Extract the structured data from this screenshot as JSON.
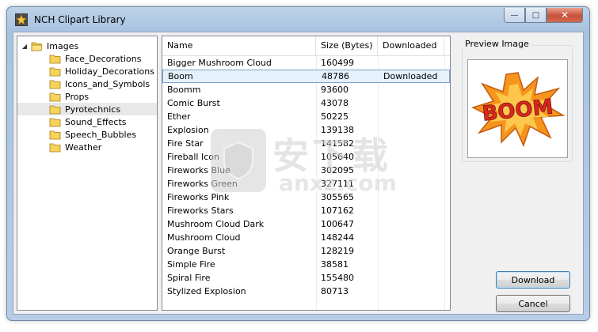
{
  "window": {
    "title": "NCH Clipart Library"
  },
  "caption_buttons": {
    "minimize": "—",
    "maximize": "□",
    "close": "✕"
  },
  "tree": {
    "root": {
      "label": "Images",
      "expander": "◢"
    },
    "items": [
      {
        "label": "Face_Decorations"
      },
      {
        "label": "Holiday_Decorations"
      },
      {
        "label": "Icons_and_Symbols"
      },
      {
        "label": "Props"
      },
      {
        "label": "Pyrotechnics",
        "selected": true
      },
      {
        "label": "Sound_Effects"
      },
      {
        "label": "Speech_Bubbles"
      },
      {
        "label": "Weather"
      }
    ]
  },
  "list": {
    "columns": {
      "name": "Name",
      "size": "Size (Bytes)",
      "downloaded": "Downloaded"
    },
    "rows": [
      {
        "name": "Bigger Mushroom Cloud",
        "size": "160499",
        "downloaded": ""
      },
      {
        "name": "Boom",
        "size": "48786",
        "downloaded": "Downloaded",
        "selected": true
      },
      {
        "name": "Boomm",
        "size": "93600",
        "downloaded": ""
      },
      {
        "name": "Comic Burst",
        "size": "43078",
        "downloaded": ""
      },
      {
        "name": "Ether",
        "size": "50225",
        "downloaded": ""
      },
      {
        "name": "Explosion",
        "size": "139138",
        "downloaded": ""
      },
      {
        "name": "Fire Star",
        "size": "141582",
        "downloaded": ""
      },
      {
        "name": "Fireball Icon",
        "size": "105640",
        "downloaded": ""
      },
      {
        "name": "Fireworks Blue",
        "size": "302095",
        "downloaded": ""
      },
      {
        "name": "Fireworks Green",
        "size": "327111",
        "downloaded": ""
      },
      {
        "name": "Fireworks Pink",
        "size": "305565",
        "downloaded": ""
      },
      {
        "name": "Fireworks Stars",
        "size": "107162",
        "downloaded": ""
      },
      {
        "name": "Mushroom Cloud Dark",
        "size": "100647",
        "downloaded": ""
      },
      {
        "name": "Mushroom Cloud",
        "size": "148244",
        "downloaded": ""
      },
      {
        "name": "Orange Burst",
        "size": "128219",
        "downloaded": ""
      },
      {
        "name": "Simple Fire",
        "size": "38581",
        "downloaded": ""
      },
      {
        "name": "Spiral Fire",
        "size": "155480",
        "downloaded": ""
      },
      {
        "name": "Stylized Explosion",
        "size": "80713",
        "downloaded": ""
      }
    ]
  },
  "preview": {
    "label": "Preview Image",
    "image_text": "BOOM"
  },
  "buttons": {
    "download": "Download",
    "cancel": "Cancel"
  },
  "watermark": {
    "text": "安下载",
    "url": "anxz.com"
  },
  "colors": {
    "selection_bg": "#e5f1fb",
    "selection_border": "#7da2ce",
    "boom_red": "#d9281e",
    "boom_orange": "#f7941d"
  }
}
